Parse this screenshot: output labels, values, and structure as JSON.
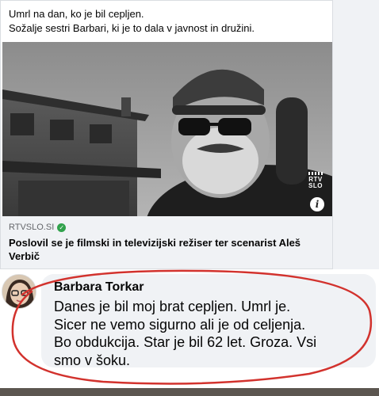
{
  "post": {
    "text_line1": "Umrl na dan, ko je bil cepljen.",
    "text_line2": "Sožalje sestri Barbari, ki je to dala v javnost in družini."
  },
  "link_preview": {
    "domain": "RTVSLO.SI",
    "title_line1": "Poslovil se je filmski in televizijski režiser ter scenarist Aleš",
    "title_line2": "Verbič",
    "badge_line1": "RTV",
    "badge_line2": "SLO",
    "info_glyph": "i",
    "verified_glyph": "✓",
    "verified_color": "#31a24c"
  },
  "comment": {
    "author": "Barbara Torkar",
    "lines": [
      "Danes je bil moj brat cepljen. Umrl je.",
      "Sicer ne vemo sigurno ali je od celjenja.",
      "Bo obdukcija. Star je bil 62 let. Groza. Vsi",
      "smo v šoku."
    ],
    "annotation_color": "#d2322d"
  },
  "colors": {
    "background": "#f0f2f5",
    "card": "#ffffff",
    "text": "#050505",
    "secondary_text": "#65676b"
  },
  "icons": [
    "verified-icon",
    "info-icon",
    "rtv-slo-logo"
  ]
}
